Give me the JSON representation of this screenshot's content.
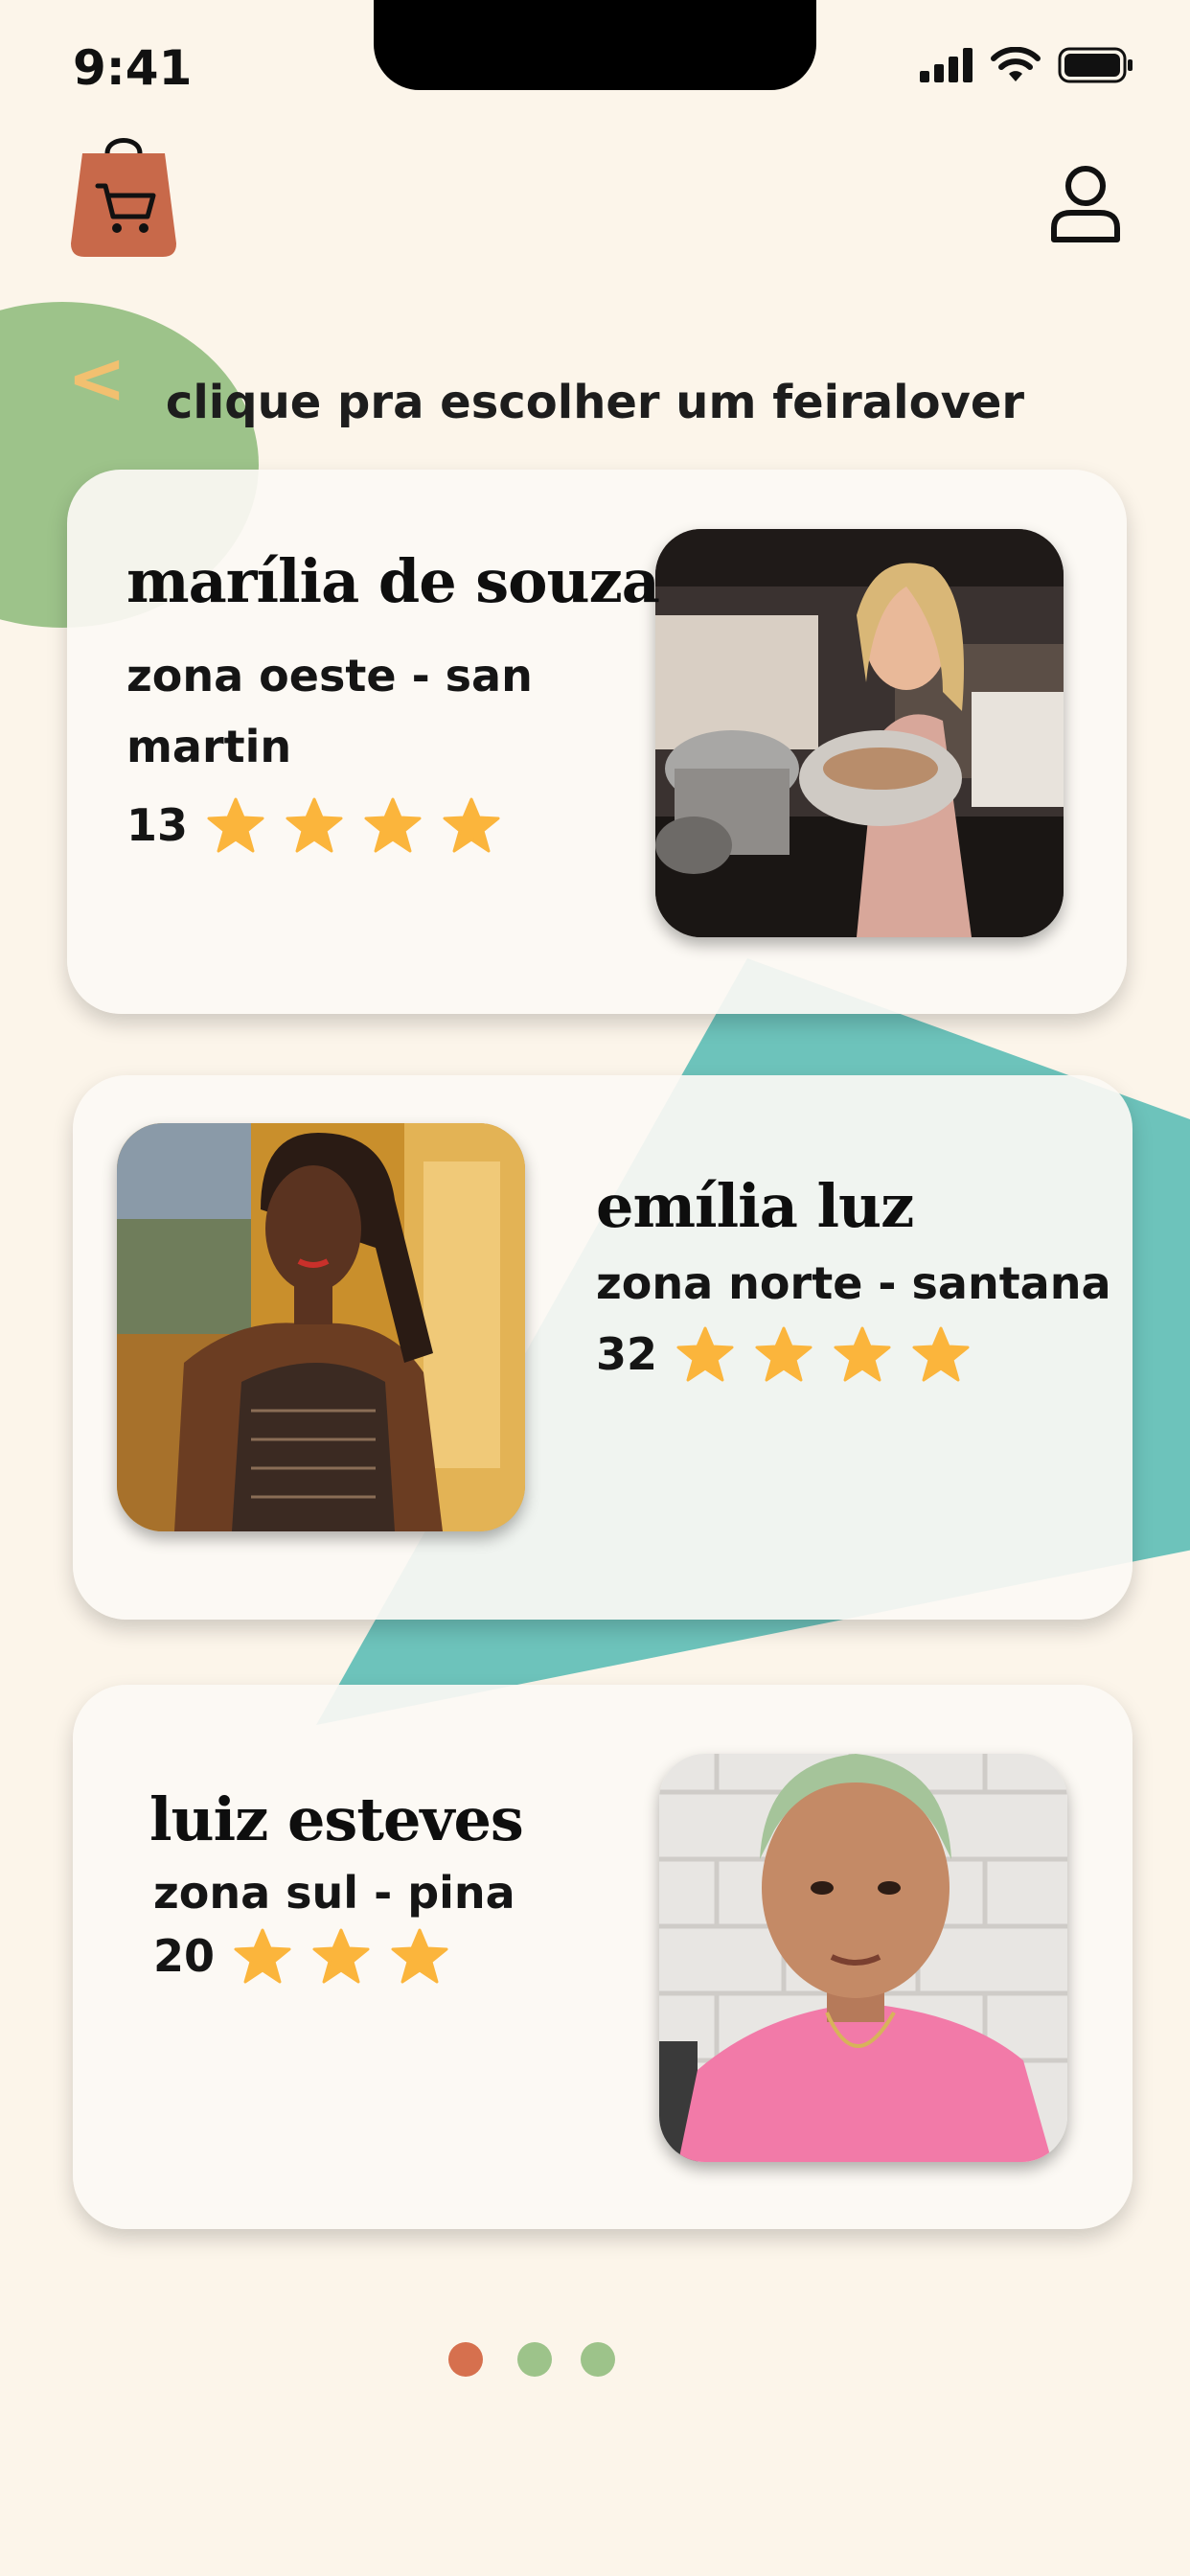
{
  "status_bar": {
    "time": "9:41"
  },
  "header": {
    "logo_icon": "shopping-bag-cart-icon",
    "profile_icon": "user-icon"
  },
  "nav": {
    "back_label": "<"
  },
  "page": {
    "subtitle": "clique pra escolher um feiralover"
  },
  "colors": {
    "background": "#fcf5ea",
    "logo": "#c8694a",
    "green": "#9dc38a",
    "teal": "#6dc3bb",
    "star": "#fbb53c",
    "dot_active": "#d6704e",
    "dot_inactive": "#9dc38a"
  },
  "feiralovers": [
    {
      "name": "marília de souza",
      "zone": "zona oeste - san martin",
      "count": "13",
      "stars": 4
    },
    {
      "name": "emília luz",
      "zone": "zona norte - santana",
      "count": "32",
      "stars": 4
    },
    {
      "name": "luiz esteves",
      "zone": "zona sul - pina",
      "count": "20",
      "stars": 3
    }
  ],
  "pagination": {
    "pages": 3,
    "current": 1
  }
}
